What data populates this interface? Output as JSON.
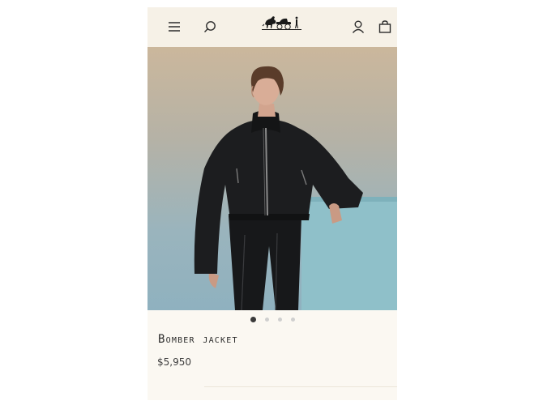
{
  "header": {
    "menu_icon": "hamburger-menu-icon",
    "search_icon": "search-icon",
    "logo_icon": "horse-carriage-logo",
    "account_icon": "user-account-icon",
    "bag_icon": "shopping-bag-icon"
  },
  "carousel": {
    "slides": 4,
    "active_index": 0
  },
  "product": {
    "name": "Bomber jacket",
    "price": "$5,950"
  },
  "colors": {
    "header_bg": "#f6f1e7",
    "page_bg": "#fbf8f2",
    "text": "#2a2a2a",
    "dot_active": "#3a3a3a",
    "dot_inactive": "#cfcfcf"
  }
}
